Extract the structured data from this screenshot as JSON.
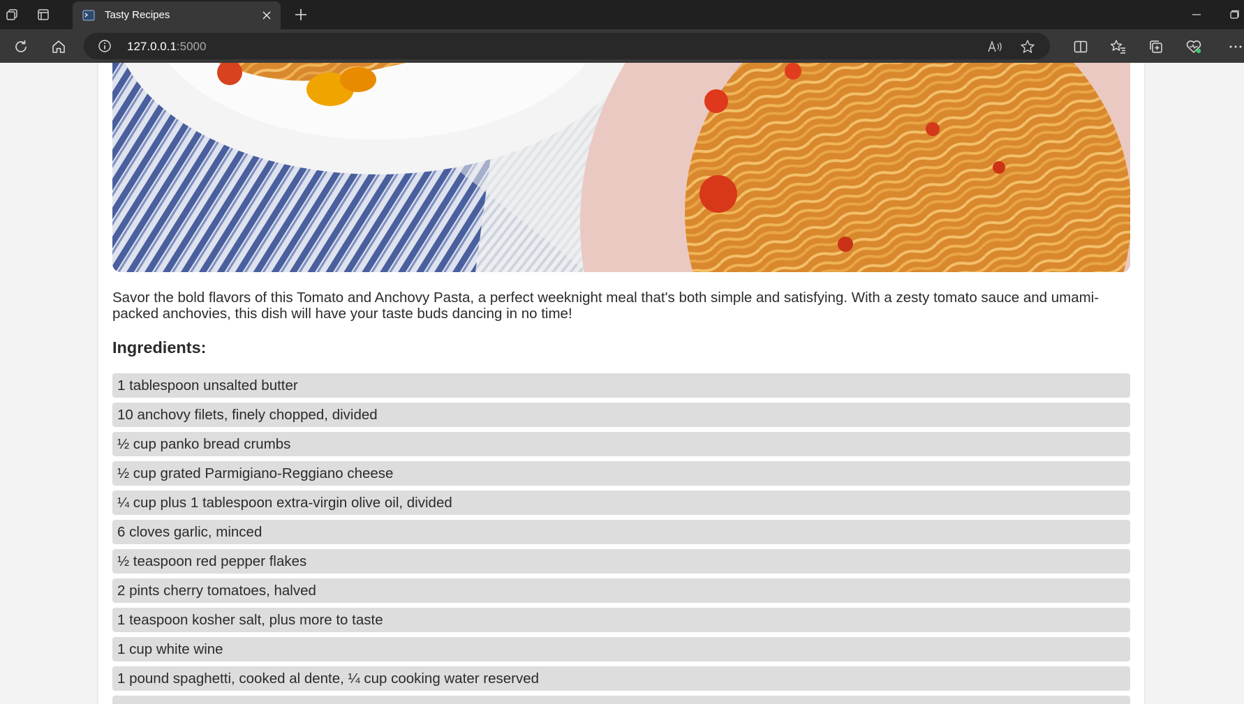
{
  "browser": {
    "tab_title": "Tasty Recipes",
    "url_host": "127.0.0.1",
    "url_port": ":5000"
  },
  "recipe": {
    "hero_image": "pasta-photo",
    "description": "Savor the bold flavors of this Tomato and Anchovy Pasta, a perfect weeknight meal that's both simple and satisfying. With a zesty tomato sauce and umami-packed anchovies, this dish will have your taste buds dancing in no time!",
    "ingredients_heading": "Ingredients:",
    "ingredients": [
      "1 tablespoon unsalted butter",
      "10 anchovy filets, finely chopped, divided",
      "½ cup panko bread crumbs",
      "½ cup grated Parmigiano-Reggiano cheese",
      "¼ cup plus 1 tablespoon extra-virgin olive oil, divided",
      "6 cloves garlic, minced",
      "½ teaspoon red pepper flakes",
      "2 pints cherry tomatoes, halved",
      "1 teaspoon kosher salt, plus more to taste",
      "1 cup white wine",
      "1 pound spaghetti, cooked al dente, ¼ cup cooking water reserved",
      ""
    ]
  },
  "colors": {
    "chrome_dark": "#202020",
    "chrome_toolbar": "#383838",
    "ingredient_bg": "#dddddd",
    "text": "#2b2b2b"
  }
}
